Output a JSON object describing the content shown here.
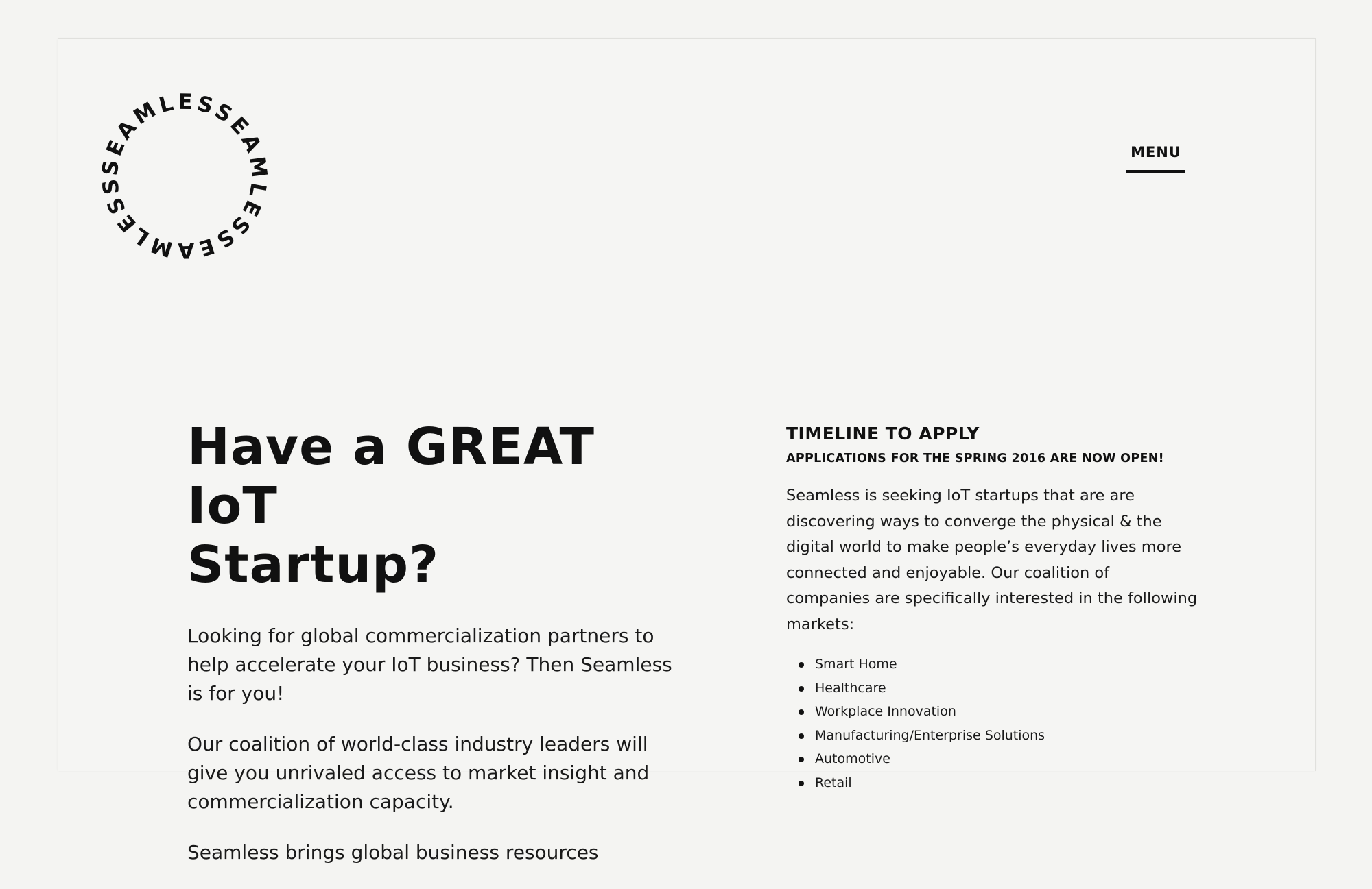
{
  "logo": {
    "text": "SEAMLESSEAMLESSEAMLESS"
  },
  "nav": {
    "menu_label": "MENU"
  },
  "hero": {
    "headline_line1": "Have a GREAT IoT",
    "headline_line2": "Startup?",
    "paragraphs": [
      "Looking for global commercialization partners to help accelerate your IoT business? Then Seamless is for you!",
      "Our coalition of world-class industry leaders will give you unrivaled access to market insight and commercialization capacity.",
      "Seamless brings global business resources"
    ]
  },
  "timeline": {
    "title": "TIMELINE TO APPLY",
    "subtitle": "APPLICATIONS FOR THE SPRING 2016 ARE NOW OPEN!",
    "body": "Seamless is seeking IoT startups that are are discovering ways to converge the physical & the digital world to make people’s everyday lives more connected and enjoyable. Our coalition of companies are specifically interested in the following markets:",
    "markets": [
      "Smart Home",
      "Healthcare",
      "Workplace Innovation",
      "Manufacturing/Enterprise Solutions",
      "Automotive",
      "Retail"
    ]
  }
}
